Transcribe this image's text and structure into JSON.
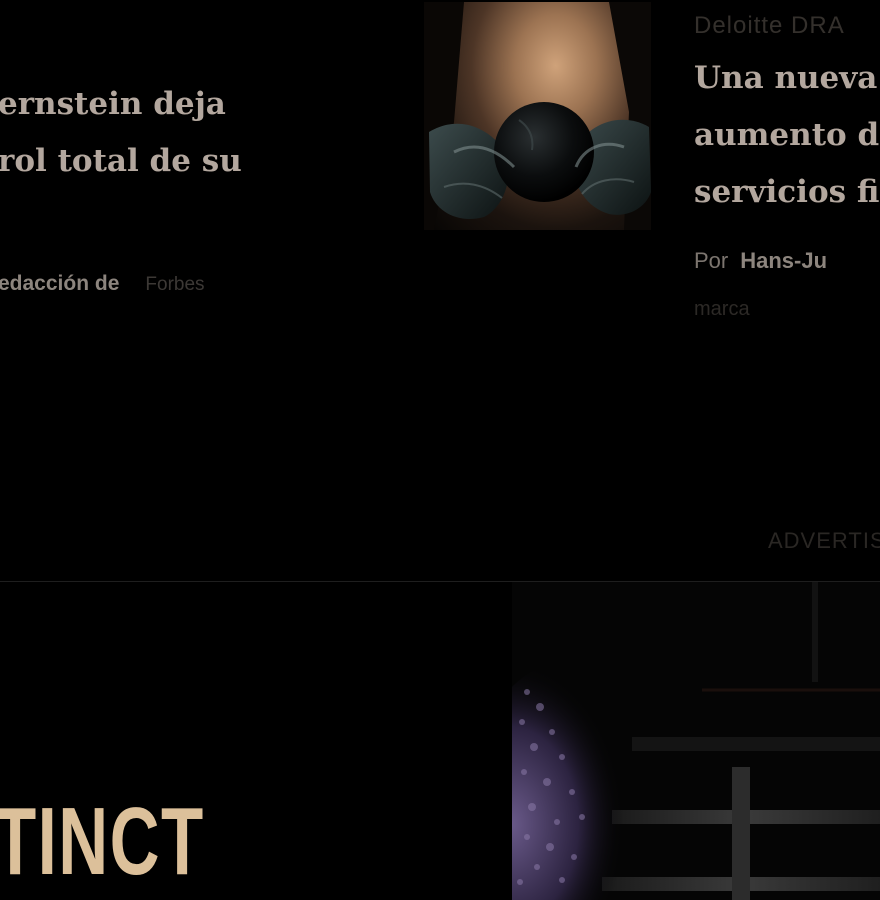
{
  "articles": [
    {
      "headline_lines": [
        "ernstein deja",
        "rol total de su"
      ],
      "byline": "edacción de",
      "brand": "Forbes"
    },
    {
      "kicker": "Deloitte DRA",
      "headline_lines": [
        "Una nueva",
        "aumento d",
        "servicios fi"
      ],
      "byline_prefix": "Por",
      "author": "Hans-Ju",
      "brand_note": "marca"
    }
  ],
  "ad": {
    "label": "ADVERTIS",
    "wordmark": "TINCT"
  },
  "colors": {
    "background": "#000000",
    "headline": "#b3a79e",
    "byline": "#8d857e",
    "ad_wordmark": "#dcc09a"
  },
  "icons": {
    "hero_thumb": "hands-holding-sphere-image",
    "ad_visual": "dark-night-scene-image"
  }
}
